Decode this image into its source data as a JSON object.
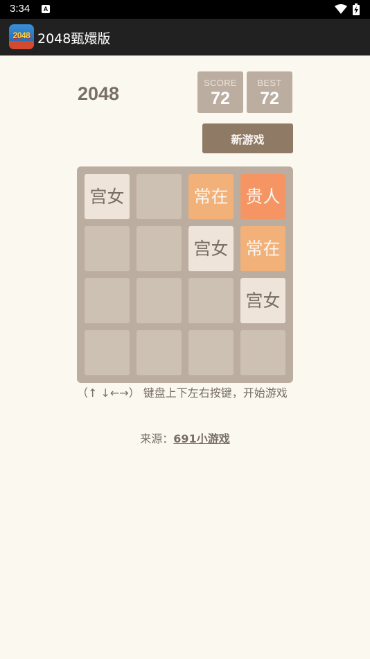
{
  "status_bar": {
    "time": "3:34",
    "notification_glyph": "A"
  },
  "app_bar": {
    "title": "2048甄嬛版",
    "icon_text": "2048"
  },
  "game": {
    "title": "2048",
    "score_label": "SCORE",
    "score_value": "72",
    "best_label": "BEST",
    "best_value": "72",
    "new_game_label": "新游戏"
  },
  "board": {
    "rows": [
      [
        "宫女",
        "",
        "常在",
        "贵人"
      ],
      [
        "",
        "",
        "宫女",
        "常在"
      ],
      [
        "",
        "",
        "",
        "宫女"
      ],
      [
        "",
        "",
        "",
        ""
      ]
    ],
    "empty_cell_color": "#cdc1b4",
    "tile_colors": {
      "宫女": {
        "bg": "#eee4da",
        "fg": "#776e65"
      },
      "常在": {
        "bg": "#f2b179",
        "fg": "#f9f6f2"
      },
      "贵人": {
        "bg": "#f59563",
        "fg": "#f9f6f2"
      }
    }
  },
  "instructions": "（↑ ↓←→） 键盘上下左右按键，开始游戏",
  "source": {
    "prefix": "来源：",
    "link_text": "691小游戏"
  },
  "colors": {
    "background": "#fbf8ef",
    "board": "#bbada0",
    "button": "#8f7a66",
    "text": "#776e65"
  }
}
